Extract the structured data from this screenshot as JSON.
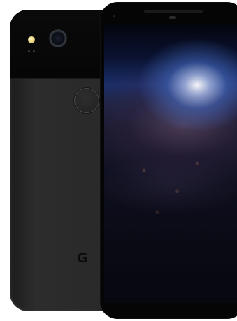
{
  "back_phone": {
    "logo_text": "G"
  },
  "colors": {
    "background": "#ffffff",
    "phone_body": "#2a2a2a",
    "glass_panel": "#080808",
    "screen_glow": "#4a6fc8"
  }
}
